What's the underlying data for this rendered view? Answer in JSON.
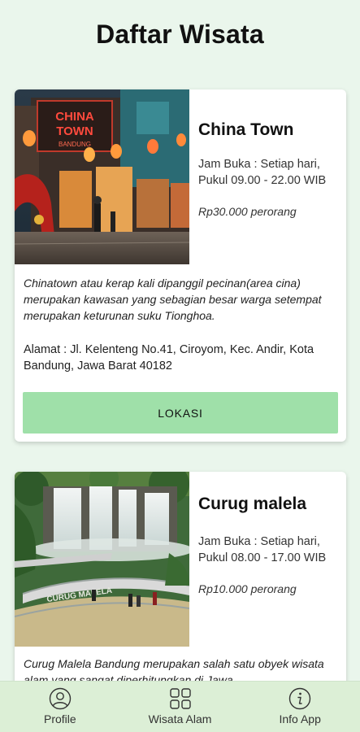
{
  "header": {
    "title": "Daftar Wisata"
  },
  "cards": [
    {
      "name": "China Town",
      "hours": "Jam Buka : Setiap hari, Pukul 09.00 - 22.00 WIB",
      "price": "Rp30.000 perorang",
      "description": "Chinatown atau kerap kali dipanggil pecinan(area cina) merupakan kawasan yang sebagian besar warga setempat merupakan keturunan suku Tionghoa.",
      "address": "Alamat : Jl. Kelenteng No.41, Ciroyom, Kec. Andir, Kota Bandung, Jawa Barat 40182",
      "button_label": "LOKASI",
      "sign_text_1": "CHINA",
      "sign_text_2": "TOWN",
      "sign_text_3": "BANDUNG"
    },
    {
      "name": "Curug malela",
      "hours": "Jam Buka : Setiap hari, Pukul 08.00 - 17.00 WIB",
      "price": "Rp10.000 perorang",
      "description": "Curug Malela Bandung merupakan salah satu obyek wisata alam yang sangat diperhitungkan di Jawa",
      "sign_text": "CURUG MALELA"
    }
  ],
  "bottom_nav": {
    "items": [
      {
        "label": "Profile",
        "icon": "person-icon"
      },
      {
        "label": "Wisata Alam",
        "icon": "grid-icon"
      },
      {
        "label": "Info App",
        "icon": "info-icon"
      }
    ]
  },
  "colors": {
    "background": "#eaf6ec",
    "button": "#9fe0a9",
    "nav": "#dcefd6"
  }
}
